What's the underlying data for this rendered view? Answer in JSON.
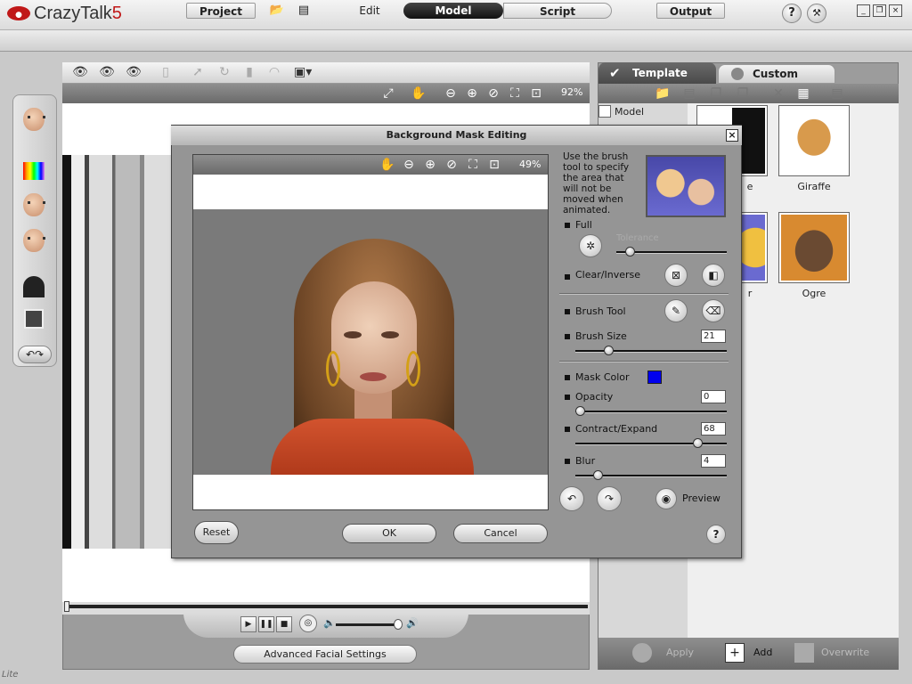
{
  "app": {
    "title": "CrazyTalk",
    "version": "5",
    "help_icon": "?"
  },
  "menu": {
    "project": "Project",
    "edit": "Edit",
    "model": "Model",
    "script": "Script",
    "output": "Output"
  },
  "canvas": {
    "zoom": "92%"
  },
  "playback": {
    "advanced_settings": "Advanced Facial Settings"
  },
  "right_panel": {
    "tab_template": "Template",
    "tab_custom": "Custom",
    "tree_item": "Model",
    "thumbnails": [
      {
        "label": "e"
      },
      {
        "label": "Giraffe"
      },
      {
        "label": "r"
      },
      {
        "label": "Ogre"
      }
    ],
    "apply": "Apply",
    "add": "Add",
    "overwrite": "Overwrite"
  },
  "dialog": {
    "title": "Background Mask Editing",
    "close": "×",
    "zoom": "49%",
    "help_text": "Use the brush tool to specify the area that will not be moved when animated.",
    "full": "Full",
    "tolerance": "Tolerance",
    "clear_inverse": "Clear/Inverse",
    "brush_tool": "Brush Tool",
    "brush_size_label": "Brush Size",
    "brush_size_value": "21",
    "mask_color_label": "Mask Color",
    "mask_color": "#0000ee",
    "opacity_label": "Opacity",
    "opacity_value": "0",
    "contract_expand_label": "Contract/Expand",
    "contract_expand_value": "68",
    "blur_label": "Blur",
    "blur_value": "4",
    "preview": "Preview",
    "reset": "Reset",
    "ok": "OK",
    "cancel": "Cancel",
    "help": "?"
  },
  "watermark": "Lite"
}
